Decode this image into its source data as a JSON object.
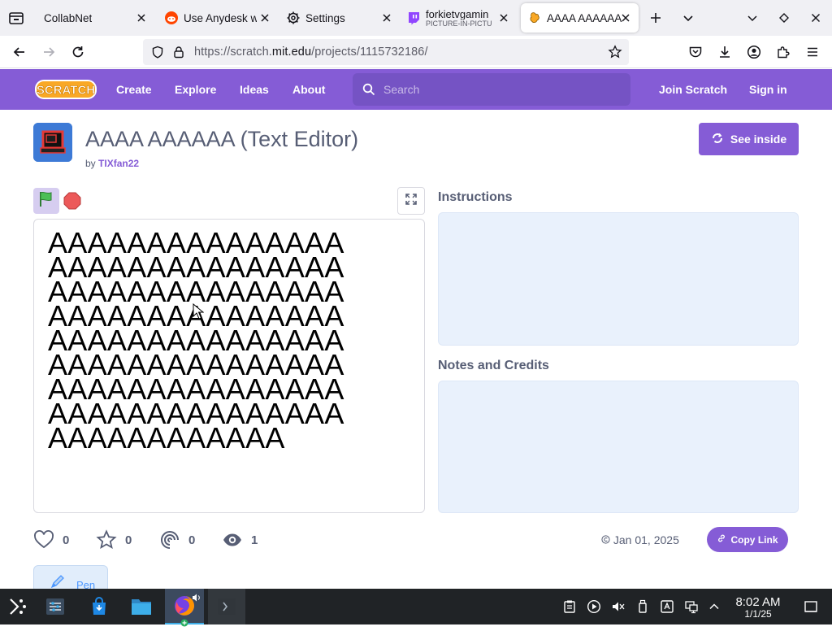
{
  "browser": {
    "tabs": [
      {
        "title": "CollabNet",
        "icon": "collabnet-icon",
        "active": false
      },
      {
        "title": "Use Anydesk w",
        "icon": "reddit-icon",
        "active": false
      },
      {
        "title": "Settings",
        "icon": "gear-icon",
        "active": false
      },
      {
        "title": "forkietvgamin",
        "subtitle": "PICTURE-IN-PICTU",
        "icon": "twitch-icon",
        "active": false
      },
      {
        "title": "AAAA AAAAAA",
        "icon": "scratch-cat-icon",
        "active": true
      }
    ],
    "url_prefix": "https://scratch.",
    "url_domain": "mit.edu",
    "url_suffix": "/projects/1115732186/"
  },
  "scratch": {
    "logo": "Scratch",
    "nav": {
      "create": "Create",
      "explore": "Explore",
      "ideas": "Ideas",
      "about": "About"
    },
    "search_placeholder": "Search",
    "join": "Join Scratch",
    "signin": "Sign in"
  },
  "project": {
    "title": "AAAA AAAAAA (Text Editor)",
    "by_prefix": "by",
    "author": "TIXfan22",
    "see_inside": "See inside",
    "stage_lines": [
      "AAAAAAAAAAAAAAA",
      "AAAAAAAAAAAAAAA",
      "AAAAAAAAAAAAAAA",
      "AAAAAAAAAAAAAAA",
      "AAAAAAAAAAAAAAA",
      "AAAAAAAAAAAAAAA",
      "AAAAAAAAAAAAAAA",
      "AAAAAAAAAAAAAAA",
      "AAAAAAAAAAAA"
    ],
    "instructions_title": "Instructions",
    "notes_title": "Notes and Credits",
    "stats": {
      "loves": "0",
      "favorites": "0",
      "remixes": "0",
      "views": "1"
    },
    "date": "Jan 01, 2025",
    "copy_link": "Copy Link",
    "extension": "Pen"
  },
  "taskbar": {
    "time": "8:02 AM",
    "date": "1/1/25"
  },
  "colors": {
    "scratch_purple": "#855cd6",
    "panel_blue": "#e9f1fc",
    "taskbar": "#202326"
  }
}
